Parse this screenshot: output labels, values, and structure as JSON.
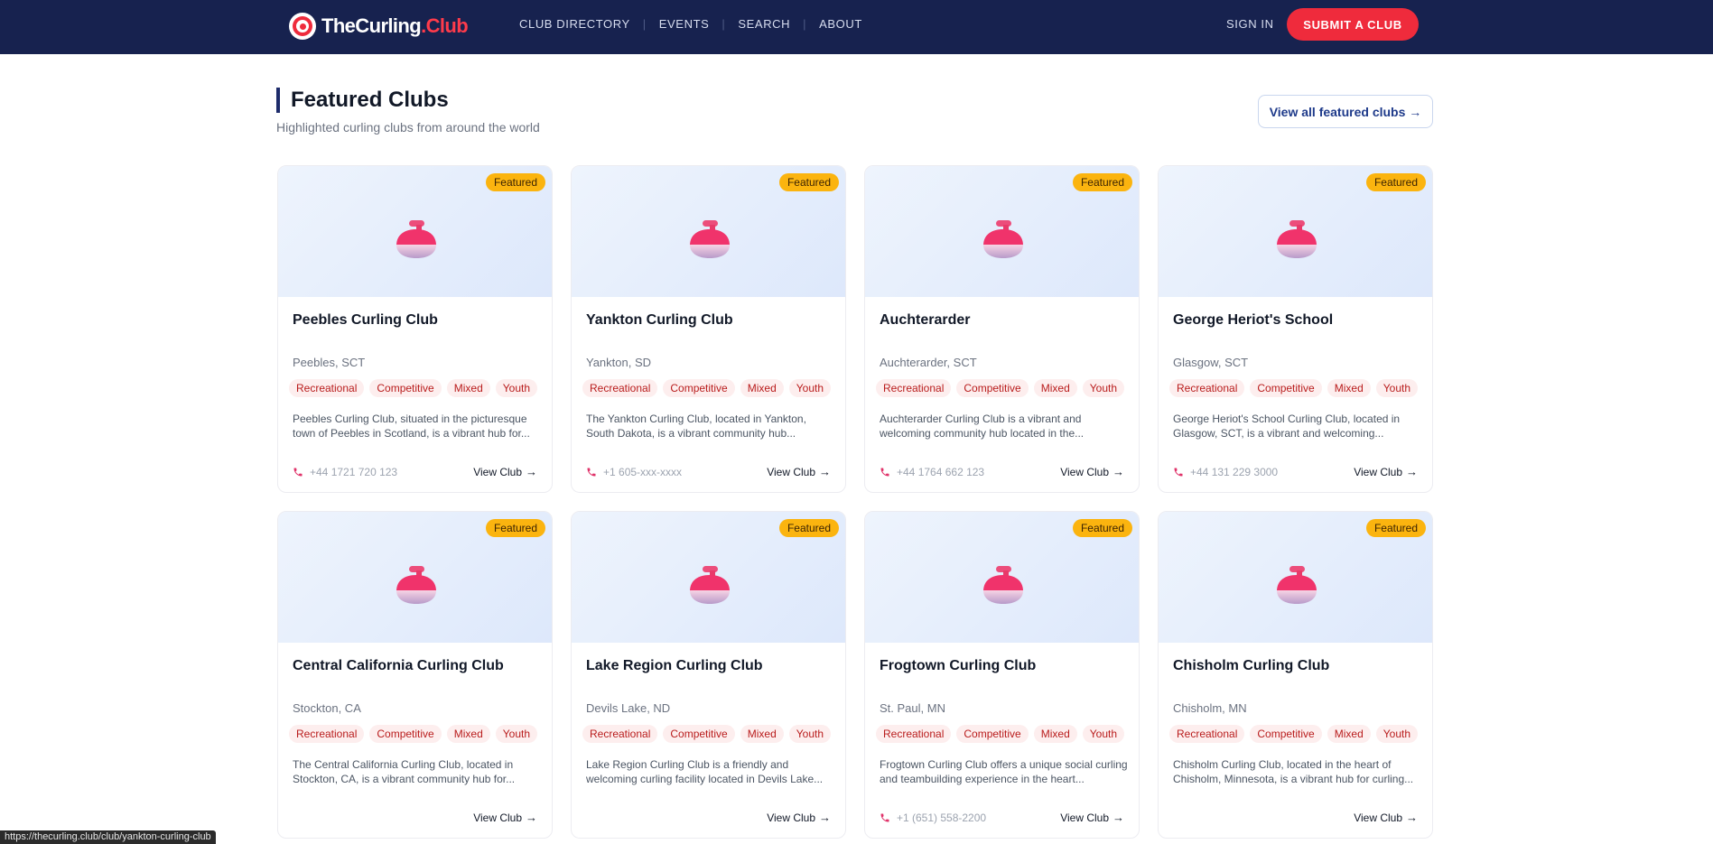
{
  "brand": {
    "name_main": "TheCurling",
    "name_dot": ".Club"
  },
  "nav": {
    "items": [
      "CLUB DIRECTORY",
      "EVENTS",
      "SEARCH",
      "ABOUT"
    ],
    "signin": "SIGN IN",
    "submit": "SUBMIT A CLUB"
  },
  "section": {
    "title": "Featured Clubs",
    "subtitle": "Highlighted curling clubs from around the world",
    "view_all": "View all featured clubs →"
  },
  "card_common": {
    "badge": "Featured",
    "view": "View Club",
    "tags": [
      "Recreational",
      "Competitive",
      "Mixed",
      "Youth"
    ]
  },
  "clubs": [
    {
      "name": "Peebles Curling Club",
      "location": "Peebles, SCT",
      "description": "Peebles Curling Club, situated in the picturesque town of Peebles in Scotland, is a vibrant hub for...",
      "phone": "+44 1721 720 123"
    },
    {
      "name": "Yankton Curling Club",
      "location": "Yankton, SD",
      "description": "The Yankton Curling Club, located in Yankton, South Dakota, is a vibrant community hub...",
      "phone": "+1 605-xxx-xxxx"
    },
    {
      "name": "Auchterarder",
      "location": "Auchterarder, SCT",
      "description": "Auchterarder Curling Club is a vibrant and welcoming community hub located in the...",
      "phone": "+44 1764 662 123"
    },
    {
      "name": "George Heriot's School",
      "location": "Glasgow, SCT",
      "description": "George Heriot's School Curling Club, located in Glasgow, SCT, is a vibrant and welcoming...",
      "phone": "+44 131 229 3000"
    },
    {
      "name": "Central California Curling Club",
      "location": "Stockton, CA",
      "description": "The Central California Curling Club, located in Stockton, CA, is a vibrant community hub for...",
      "phone": ""
    },
    {
      "name": "Lake Region Curling Club",
      "location": "Devils Lake, ND",
      "description": "Lake Region Curling Club is a friendly and welcoming curling facility located in Devils Lake...",
      "phone": ""
    },
    {
      "name": "Frogtown Curling Club",
      "location": "St. Paul, MN",
      "description": "Frogtown Curling Club offers a unique social curling and teambuilding experience in the heart...",
      "phone": "+1 (651) 558-2200"
    },
    {
      "name": "Chisholm Curling Club",
      "location": "Chisholm, MN",
      "description": "Chisholm Curling Club, located in the heart of Chisholm, Minnesota, is a vibrant hub for curling...",
      "phone": ""
    }
  ],
  "status_url": "https://thecurling.club/club/yankton-curling-club",
  "colors": {
    "navbar": "#17224f",
    "accent": "#ef2b3c",
    "badge": "#fbb40f",
    "tag_bg": "#fdeeee",
    "tag_text": "#b91c1c"
  },
  "icons": {
    "stone": "curling-stone-icon",
    "phone": "phone-icon",
    "arrow": "arrow-right-icon"
  }
}
